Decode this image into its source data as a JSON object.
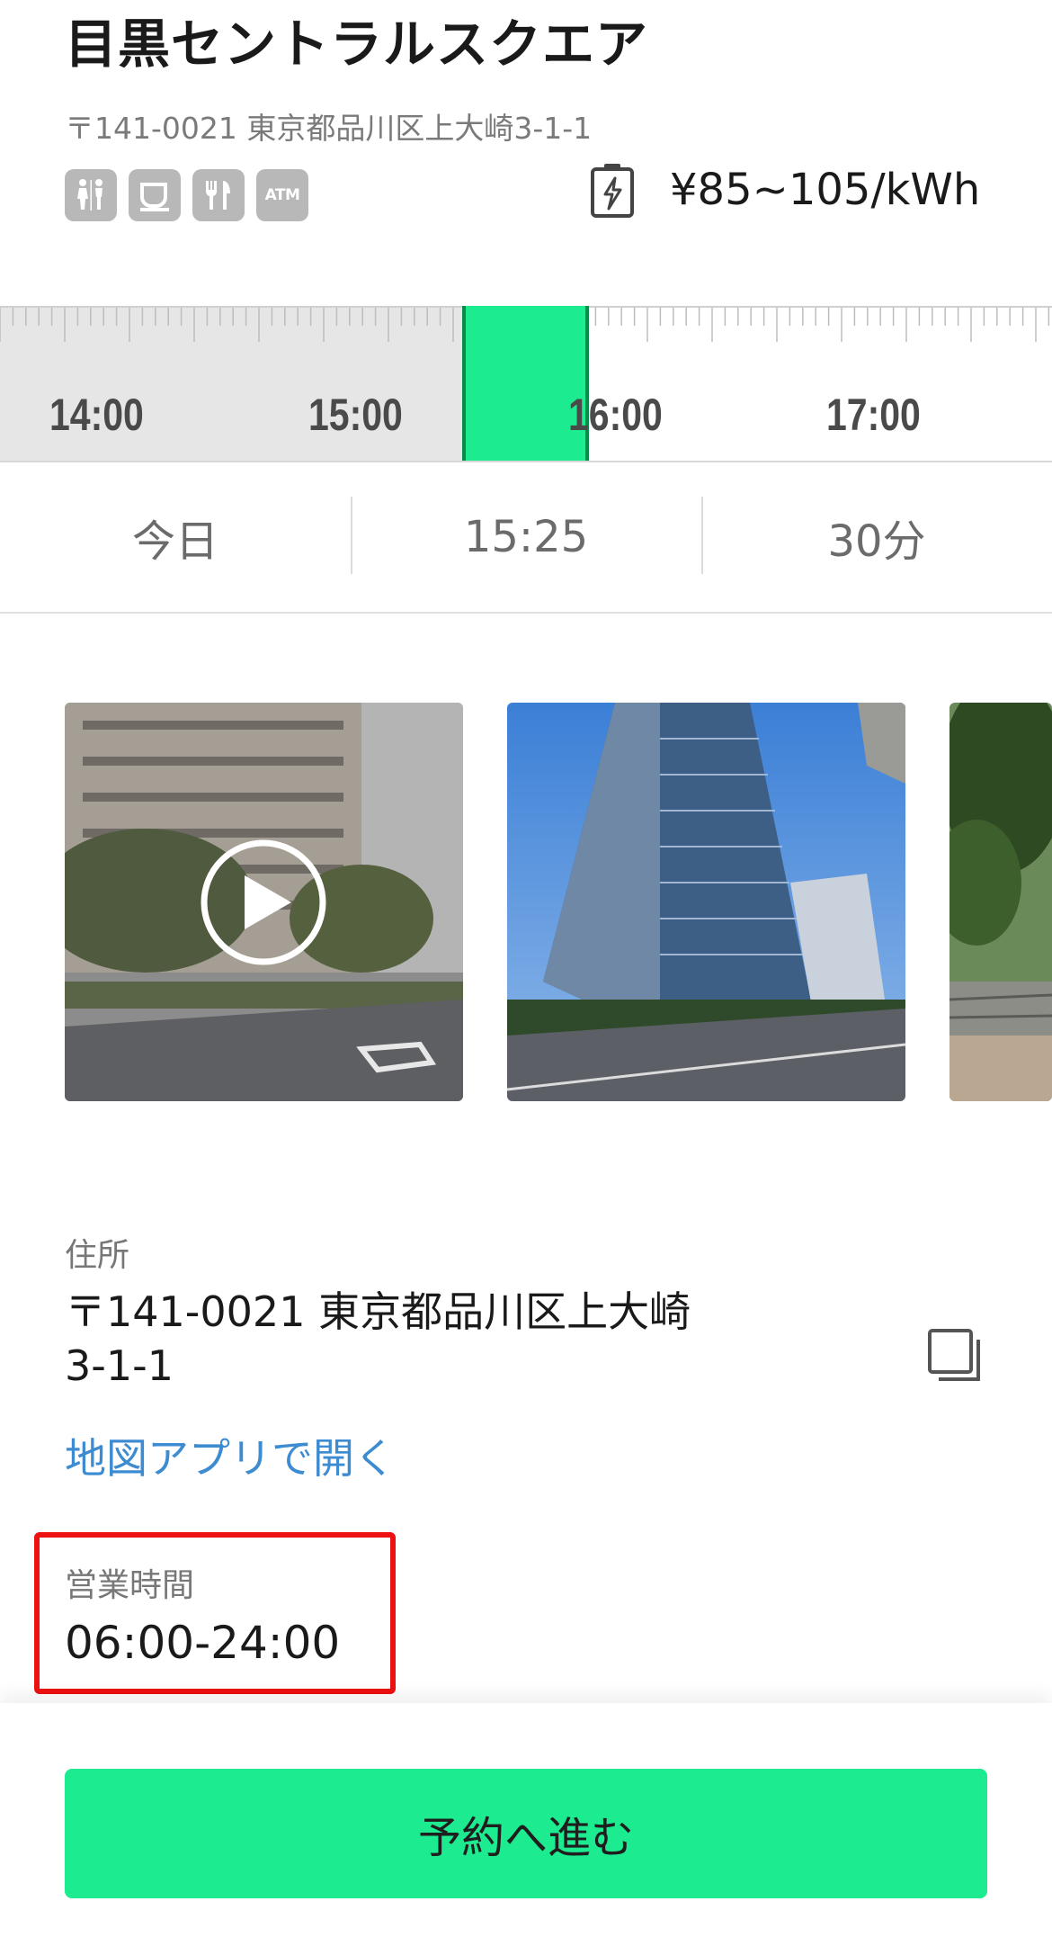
{
  "station": {
    "name": "目黒セントラルスクエア",
    "address_line": "〒141-0021 東京都品川区上大崎3-1-1",
    "amenities": [
      "restroom-icon",
      "cafe-icon",
      "restaurant-icon",
      "atm-icon"
    ],
    "atm_text": "ATM",
    "price": "¥85~105/kWh"
  },
  "timeline": {
    "labels": [
      "14:00",
      "15:00",
      "16:00",
      "17:00"
    ],
    "selected_start": "15:25",
    "selected_duration_minutes": 30
  },
  "selector": {
    "date": "今日",
    "time": "15:25",
    "duration": "30分"
  },
  "photos": [
    {
      "kind": "video",
      "icon": "play-icon"
    },
    {
      "kind": "image"
    },
    {
      "kind": "image"
    }
  ],
  "details": {
    "address_label": "住所",
    "address_line1": "〒141-0021 東京都品川区上大崎",
    "address_line2": "3-1-1",
    "map_link": "地図アプリで開く",
    "hours_label": "営業時間",
    "hours_value": "06:00-24:00"
  },
  "cta": {
    "label": "予約へ進む"
  },
  "colors": {
    "accent_green": "#1ceb90",
    "link_blue": "#3d8bd1",
    "highlight_red": "#ee1111"
  }
}
